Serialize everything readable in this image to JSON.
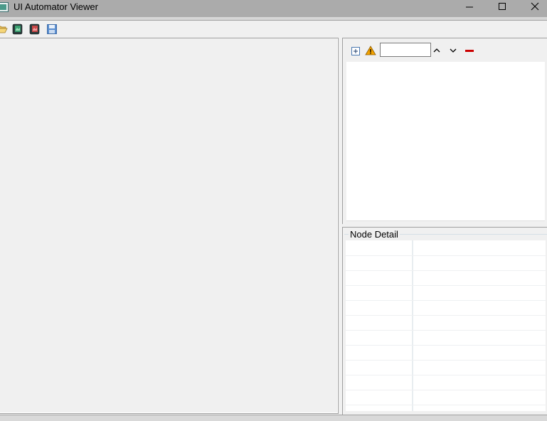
{
  "window": {
    "title": "UI Automator Viewer",
    "controls": [
      "minimize",
      "maximize",
      "close"
    ]
  },
  "toolbar": {
    "buttons": [
      {
        "name": "open",
        "icon": "folder-open-icon"
      },
      {
        "name": "device-screenshot",
        "icon": "device-screenshot-icon"
      },
      {
        "name": "device-screenshot-compressed",
        "icon": "device-screenshot-compressed-icon"
      },
      {
        "name": "save",
        "icon": "save-icon"
      }
    ]
  },
  "tree_toolbar": {
    "expand_all_icon": "expand-all-icon",
    "warning_icon": "warning-icon",
    "search_value": "",
    "previous_icon": "chevron-up-icon",
    "next_icon": "chevron-down-icon",
    "clear_icon": "clear-icon"
  },
  "node_detail": {
    "title": "Node Detail",
    "rows": []
  },
  "colors": {
    "titlebar": "#ababab",
    "panel_bg": "#f0f0f0",
    "clear_red": "#cc0000",
    "warning_orange": "#f4a300"
  }
}
